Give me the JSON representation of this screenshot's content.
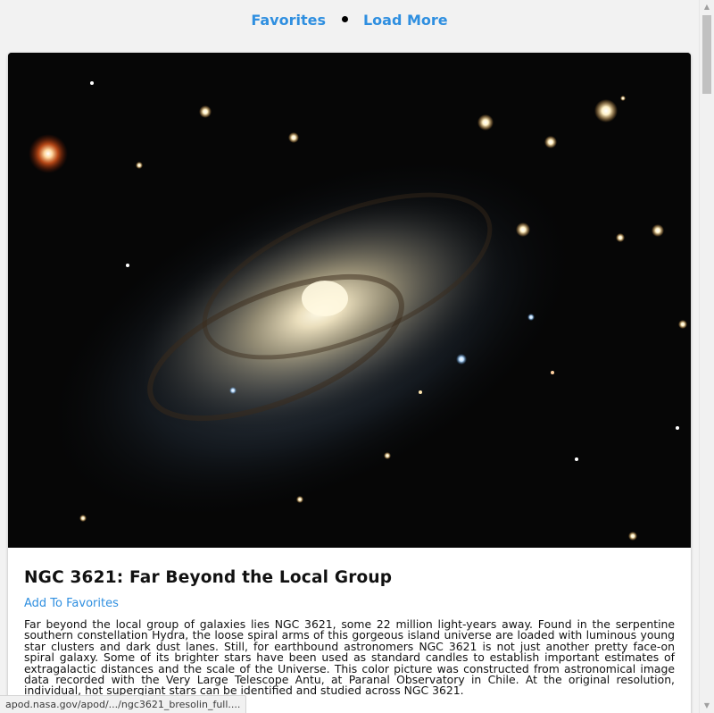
{
  "nav": {
    "favorites_label": "Favorites",
    "load_more_label": "Load More"
  },
  "post": {
    "title": "NGC 3621: Far Beyond the Local Group",
    "add_favorites_label": "Add To Favorites",
    "image_alt": "NGC 3621",
    "description": "Far beyond the local group of galaxies lies NGC 3621, some 22 million light-years away. Found in the serpentine southern constellation Hydra, the loose spiral arms of this gorgeous island universe are loaded with luminous young star clusters and dark dust lanes. Still, for earthbound astronomers NGC 3621 is not just another pretty face-on spiral galaxy. Some of its brighter stars have been used as standard candles to establish important estimates of extragalactic distances and the scale of the Universe. This color picture was constructed from astronomical image data recorded with the Very Large Telescope Antu, at Paranal Observatory in Chile. At the original resolution, individual, hot supergiant stars can be identified and studied across NGC 3621."
  },
  "status_bar": {
    "url": "apod.nasa.gov/apod/.../ngc3621_bresolin_full...."
  },
  "colors": {
    "link": "#2f8fe0",
    "page_background": "#f2f2f2",
    "card_background": "#ffffff"
  }
}
